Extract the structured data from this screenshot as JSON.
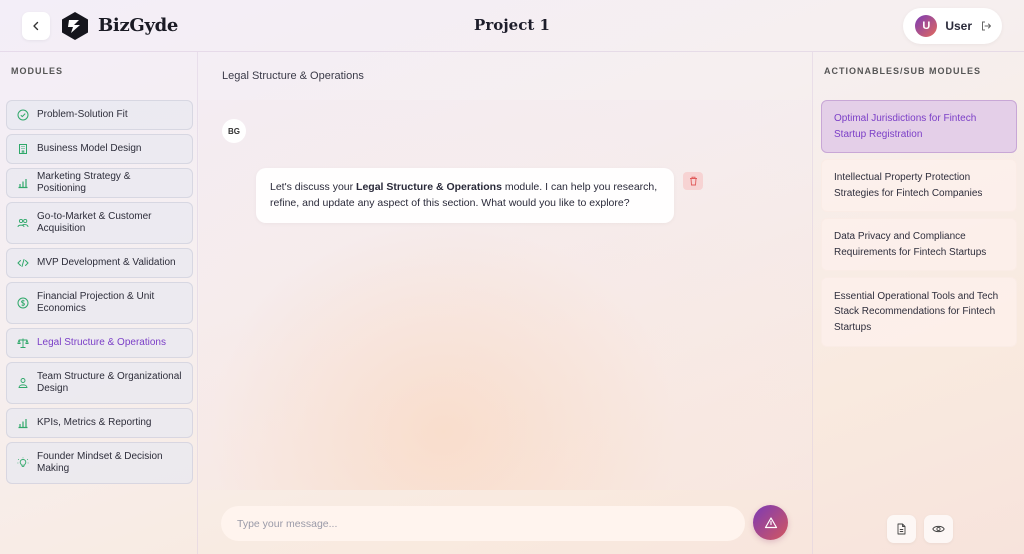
{
  "header": {
    "brand": "BizGyde",
    "title": "Project 1",
    "user_initial": "U",
    "user_name": "User"
  },
  "modules": {
    "label": "MODULES",
    "items": [
      {
        "label": "Problem-Solution Fit",
        "icon": "check-circle-icon"
      },
      {
        "label": "Business Model Design",
        "icon": "building-icon"
      },
      {
        "label": "Marketing Strategy & Positioning",
        "icon": "bar-chart-icon"
      },
      {
        "label": "Go-to-Market & Customer Acquisition",
        "icon": "users-icon"
      },
      {
        "label": "MVP Development & Validation",
        "icon": "code-icon"
      },
      {
        "label": "Financial Projection & Unit Economics",
        "icon": "dollar-icon"
      },
      {
        "label": "Legal Structure & Operations",
        "icon": "scale-icon",
        "active": true
      },
      {
        "label": "Team Structure & Organizational Design",
        "icon": "team-icon"
      },
      {
        "label": "KPIs, Metrics & Reporting",
        "icon": "bar-chart-icon"
      },
      {
        "label": "Founder Mindset & Decision Making",
        "icon": "lightbulb-icon"
      }
    ]
  },
  "chat": {
    "heading": "Legal Structure & Operations",
    "bot_initials": "BG",
    "message_pre": "Let's discuss your ",
    "message_bold": "Legal Structure & Operations",
    "message_post": " module. I can help you research, refine, and update any aspect of this section. What would you like to explore?",
    "input_placeholder": "Type your message..."
  },
  "actionables": {
    "label": "ACTIONABLES/SUB MODULES",
    "items": [
      {
        "label": "Optimal Jurisdictions for Fintech Startup Registration",
        "active": true
      },
      {
        "label": "Intellectual Property Protection Strategies for Fintech Companies"
      },
      {
        "label": "Data Privacy and Compliance Requirements for Fintech Startups"
      },
      {
        "label": "Essential Operational Tools and Tech Stack Recommendations for Fintech Startups"
      }
    ]
  },
  "colors": {
    "accent": "#7b3fc7",
    "icon_green": "#2fa86a",
    "trash_red": "#e05a5a"
  }
}
